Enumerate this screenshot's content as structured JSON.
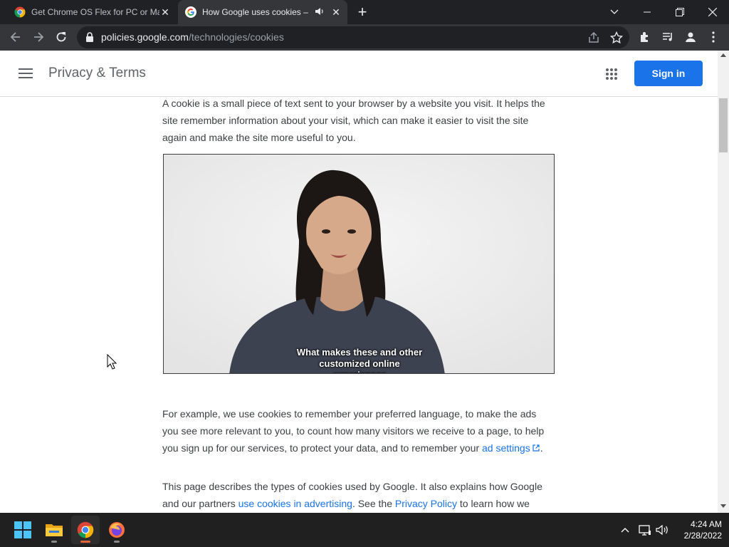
{
  "browser": {
    "tabs": [
      {
        "title": "Get Chrome OS Flex for PC or Ma",
        "active": false
      },
      {
        "title": "How Google uses cookies – P",
        "active": true
      }
    ],
    "url": {
      "host": "policies.google.com",
      "path": "/technologies/cookies"
    }
  },
  "header": {
    "brand": "Privacy & Terms",
    "signin_label": "Sign in"
  },
  "content": {
    "intro": "A cookie is a small piece of text sent to your browser by a website you visit. It helps the site remember information about your visit, which can make it easier to visit the site again and make the site more useful to you.",
    "video_caption_line1": "What makes these and other",
    "video_caption_line2": "customized online experiences",
    "p2_text": "For example, we use cookies to remember your preferred language, to make the ads you see more relevant to you, to count how many visitors we receive to a page, to help you sign up for our services, to protect your data, and to remember your ",
    "p2_link": "ad settings",
    "p2_end": ".",
    "p3_text1": "This page describes the types of cookies used by Google. It also explains how Google and our partners ",
    "p3_link1": "use cookies in advertising",
    "p3_text2": ". See the ",
    "p3_link2": "Privacy Policy",
    "p3_text3": " to learn how we"
  },
  "taskbar": {
    "time": "4:24 AM",
    "date": "2/28/2022"
  },
  "colors": {
    "accent": "#1a73e8",
    "chrome_dark": "#202124",
    "chrome_toolbar": "#35363a",
    "taskbar": "#202020"
  }
}
